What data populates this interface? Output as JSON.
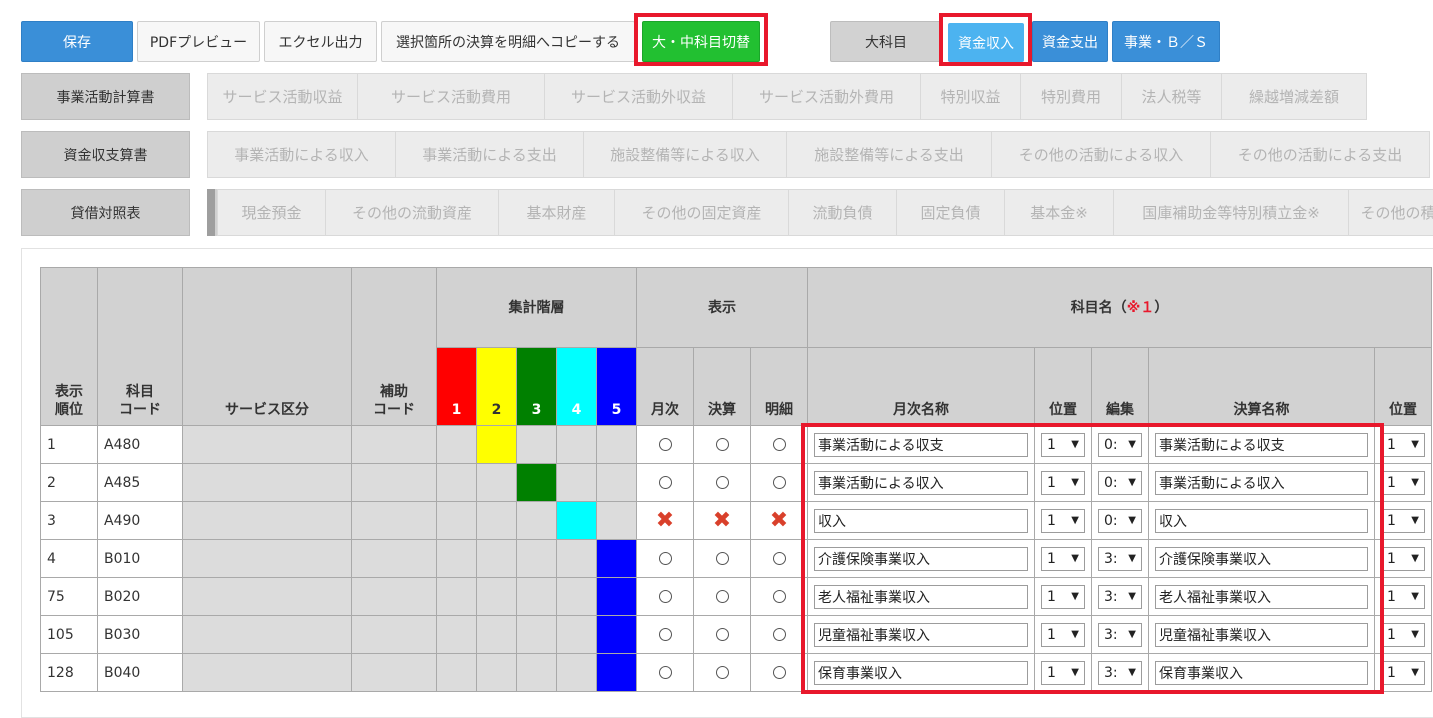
{
  "toolbar": {
    "save": "保存",
    "pdf_preview": "PDFプレビュー",
    "excel_export": "エクセル出力",
    "copy_to_detail": "選択箇所の決算を明細へコピーする",
    "toggle_category": "大・中科目切替",
    "major_item": "大科目",
    "fund_income": "資金収入",
    "fund_expense": "資金支出",
    "business_bs": "事業・Ｂ／Ｓ"
  },
  "statements": [
    {
      "label": "事業活動計算書",
      "tabs": [
        "サービス活動収益",
        "サービス活動費用",
        "サービス活動外収益",
        "サービス活動外費用",
        "特別収益",
        "特別費用",
        "法人税等",
        "繰越増減差額"
      ]
    },
    {
      "label": "資金収支算書",
      "tabs": [
        "事業活動による収入",
        "事業活動による支出",
        "施設整備等による収入",
        "施設整備等による支出",
        "その他の活動による収入",
        "その他の活動による支出"
      ]
    },
    {
      "label": "貸借対照表",
      "tabs": [
        "現金預金",
        "その他の流動資産",
        "基本財産",
        "その他の固定資産",
        "流動負債",
        "固定負債",
        "基本金※",
        "国庫補助金等特別積立金※",
        "その他の積"
      ]
    }
  ],
  "table": {
    "headers": {
      "order": "表示\n順位",
      "code": "科目\nコード",
      "service": "サービス区分",
      "sub_code": "補助\nコード",
      "level_group": "集計階層",
      "display_group": "表示",
      "name_group": "科目名（",
      "name_group_mark": "※１",
      "name_group_close": "）",
      "monthly": "月次",
      "settlement": "決算",
      "detail": "明細",
      "monthly_name": "月次名称",
      "position": "位置",
      "edit": "編集",
      "settlement_name": "決算名称",
      "position2": "位置",
      "levels": [
        "1",
        "2",
        "3",
        "4",
        "5"
      ]
    },
    "level_colors": [
      "#ff0000",
      "#ffff00",
      "#008000",
      "#00ffff",
      "#0000ff"
    ],
    "rows": [
      {
        "order": "1",
        "code": "A480",
        "level": 2,
        "mark": "circle",
        "monthly_name": "事業活動による収支",
        "position": "1",
        "edit": "0:",
        "settlement_name": "事業活動による収支",
        "position2": "1"
      },
      {
        "order": "2",
        "code": "A485",
        "level": 3,
        "mark": "circle",
        "monthly_name": "事業活動による収入",
        "position": "1",
        "edit": "0:",
        "settlement_name": "事業活動による収入",
        "position2": "1"
      },
      {
        "order": "3",
        "code": "A490",
        "level": 4,
        "mark": "x",
        "monthly_name": "収入",
        "position": "1",
        "edit": "0:",
        "settlement_name": "収入",
        "position2": "1"
      },
      {
        "order": "4",
        "code": "B010",
        "level": 5,
        "mark": "circle",
        "monthly_name": "介護保険事業収入",
        "position": "1",
        "edit": "3:",
        "settlement_name": "介護保険事業収入",
        "position2": "1"
      },
      {
        "order": "75",
        "code": "B020",
        "level": 5,
        "mark": "circle",
        "monthly_name": "老人福祉事業収入",
        "position": "1",
        "edit": "3:",
        "settlement_name": "老人福祉事業収入",
        "position2": "1"
      },
      {
        "order": "105",
        "code": "B030",
        "level": 5,
        "mark": "circle",
        "monthly_name": "児童福祉事業収入",
        "position": "1",
        "edit": "3:",
        "settlement_name": "児童福祉事業収入",
        "position2": "1"
      },
      {
        "order": "128",
        "code": "B040",
        "level": 5,
        "mark": "circle",
        "monthly_name": "保育事業収入",
        "position": "1",
        "edit": "3:",
        "settlement_name": "保育事業収入",
        "position2": "1"
      }
    ]
  }
}
